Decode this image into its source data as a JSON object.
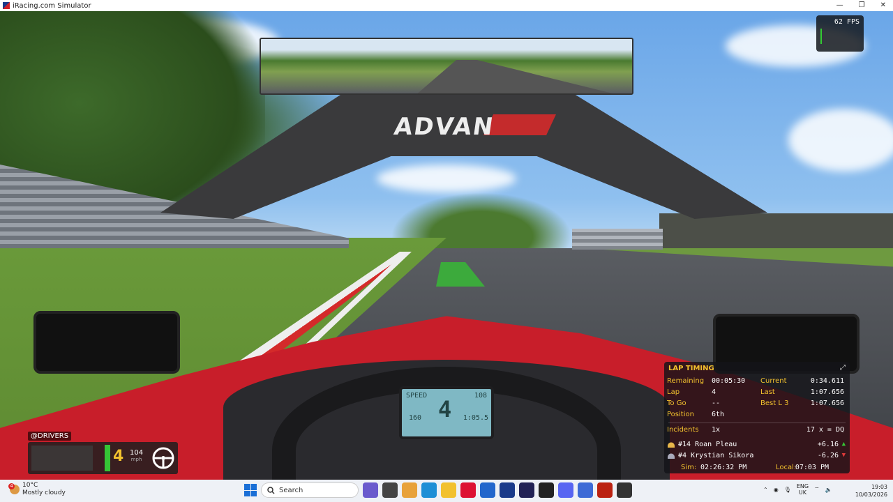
{
  "window": {
    "title": "iRacing.com Simulator",
    "minimize": "—",
    "maximize": "❐",
    "close": "✕"
  },
  "scene": {
    "bridge_text": "ADVAN"
  },
  "fps": {
    "value": "62 FPS"
  },
  "dashboard": {
    "gear": "4",
    "top_left": "SPEED",
    "top_right": "108",
    "bottom_left": "160",
    "bottom_right": "1:05.5"
  },
  "drivers_widget": {
    "label": "@DRIVERS",
    "gear": "4",
    "speed": "104",
    "speed_unit": "mph"
  },
  "lap_timing": {
    "title": "LAP TIMING",
    "remaining_label": "Remaining",
    "remaining": "00:05:30",
    "lap_label": "Lap",
    "lap": "4",
    "to_go_label": "To Go",
    "to_go": "--",
    "position_label": "Position",
    "position": "6th",
    "current_label": "Current",
    "current": "0:34.611",
    "last_label": "Last",
    "last": "1:07.656",
    "best_label": "Best L 3",
    "best": "1:07.656",
    "incidents_label": "Incidents",
    "incidents": "1x",
    "dq_limit": "17 x = DQ",
    "drivers": [
      {
        "name": "#14 Roan Pleau",
        "delta": "+6.16",
        "trend": "up",
        "color": "#35c535"
      },
      {
        "name": "#4 Krystian Sikora",
        "delta": "-6.26",
        "trend": "down",
        "color": "#e03a3a"
      }
    ],
    "sim_label": "Sim:",
    "sim_time": "02:26:32 PM",
    "local_label": "Local:",
    "local_time": "07:03 PM"
  },
  "taskbar": {
    "weather_temp": "10°C",
    "weather_desc": "Mostly cloudy",
    "notification_count": "4",
    "search_placeholder": "Search",
    "lang_top": "ENG",
    "lang_bottom": "UK",
    "time": "19:03",
    "date": "10/03/2026"
  }
}
